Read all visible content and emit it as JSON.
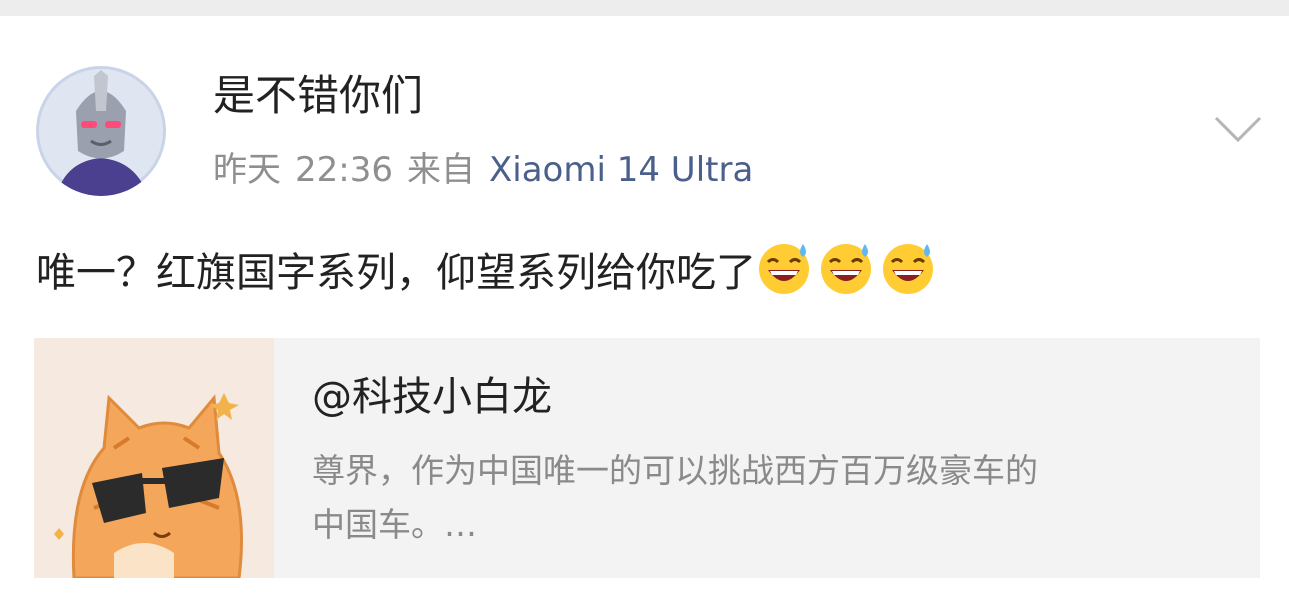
{
  "post": {
    "username": "是不错你们",
    "date": "昨天",
    "time": "22:36",
    "source_prefix": "来自",
    "device": "Xiaomi 14 Ultra",
    "text": "唯一？红旗国字系列，仰望系列给你吃了",
    "emoji": [
      "sweat-smile-emoji",
      "sweat-smile-emoji",
      "sweat-smile-emoji"
    ]
  },
  "quote_card": {
    "title": "@科技小白龙",
    "description": "尊界，作为中国唯一的可以挑战西方百万级豪车的\n中国车。…"
  },
  "colors": {
    "device_link": "#4a5f8c",
    "meta_text": "#8f8f8f",
    "card_bg": "#f3f3f3"
  }
}
